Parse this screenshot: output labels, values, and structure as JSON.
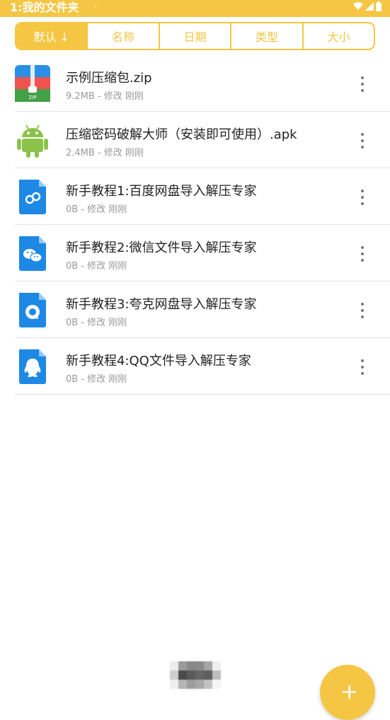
{
  "status_bar": {
    "title": "1:我的文件夹",
    "dot": "·",
    "background": "#f5c643"
  },
  "sort_tabs": [
    {
      "label": "默认 ↓",
      "active": true
    },
    {
      "label": "名称",
      "active": false
    },
    {
      "label": "日期",
      "active": false
    },
    {
      "label": "类型",
      "active": false
    },
    {
      "label": "大小",
      "active": false
    }
  ],
  "files": [
    {
      "name": "示例压缩包.zip",
      "meta": "9.2MB - 修改 刚刚",
      "icon": "zip-icon"
    },
    {
      "name": "压缩密码破解大师（安装即可使用）.apk",
      "meta": "2.4MB - 修改 刚刚",
      "icon": "android-icon"
    },
    {
      "name": "新手教程1:百度网盘导入解压专家",
      "meta": "0B - 修改 刚刚",
      "icon": "baidu-netdisk-icon"
    },
    {
      "name": "新手教程2:微信文件导入解压专家",
      "meta": "0B - 修改 刚刚",
      "icon": "wechat-icon"
    },
    {
      "name": "新手教程3:夸克网盘导入解压专家",
      "meta": "0B - 修改 刚刚",
      "icon": "quark-icon"
    },
    {
      "name": "新手教程4:QQ文件导入解压专家",
      "meta": "0B - 修改 刚刚",
      "icon": "qq-icon"
    }
  ],
  "fab": {
    "label": "+",
    "icon": "plus-icon"
  },
  "colors": {
    "accent": "#f5c643",
    "file_blue": "#1e88e5",
    "android_green": "#8bc34a"
  }
}
